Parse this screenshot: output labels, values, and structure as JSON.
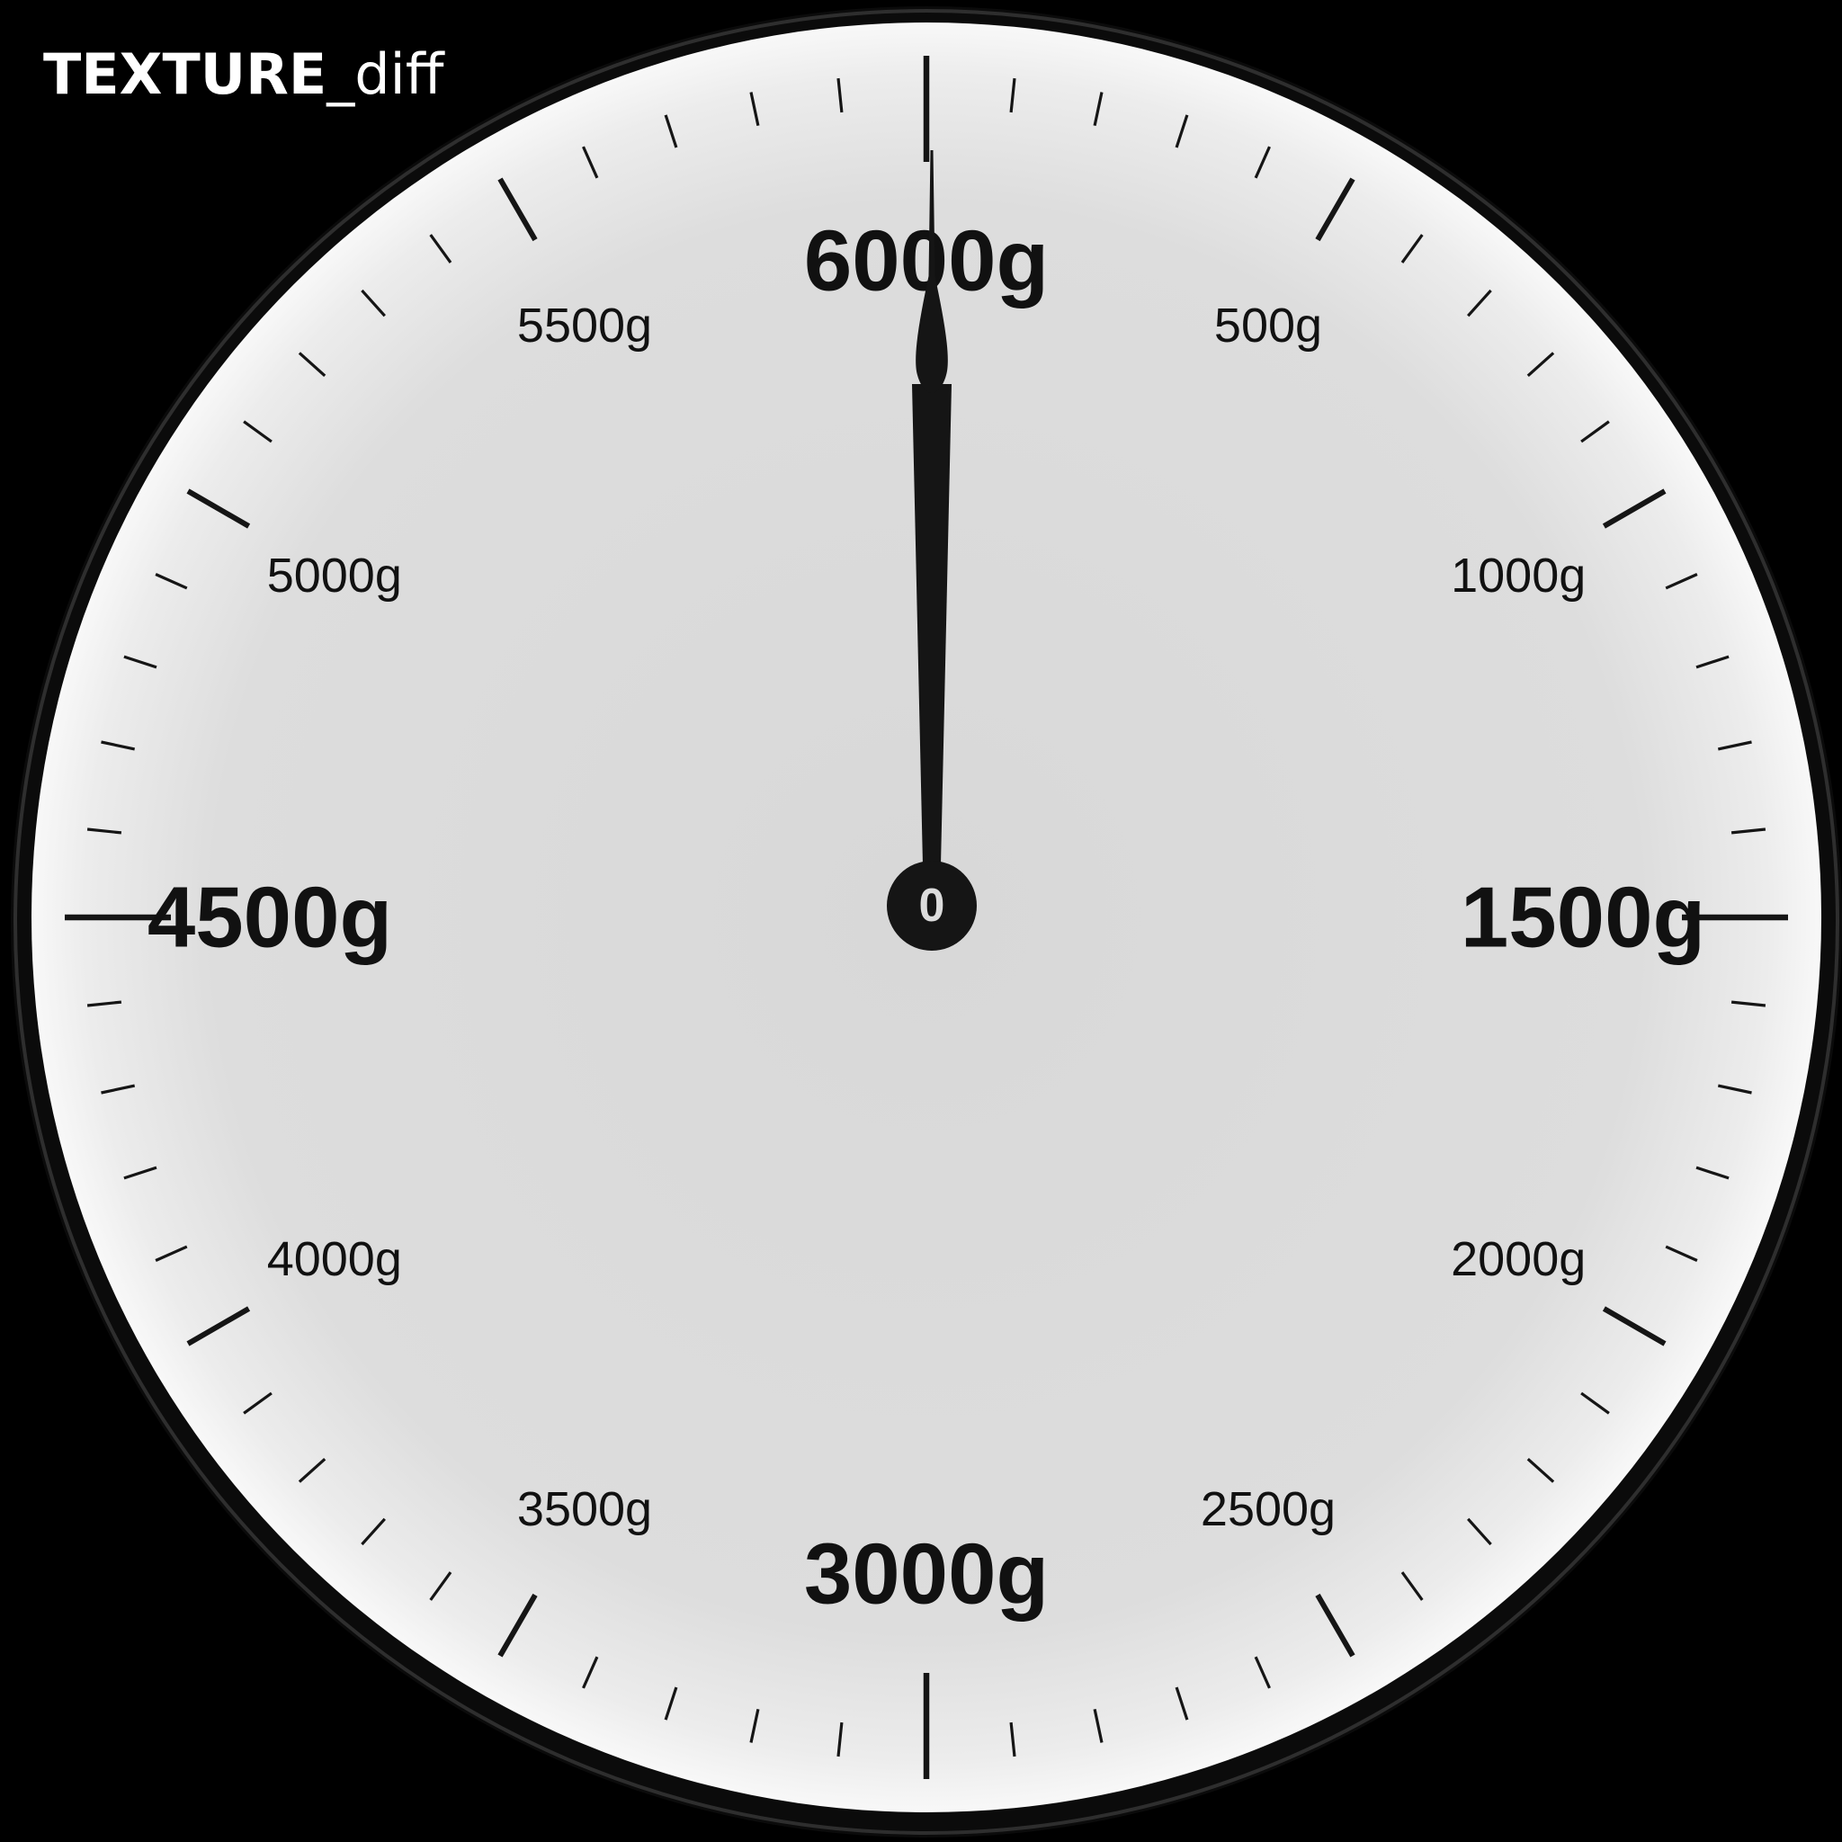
{
  "brand": {
    "bold": "TEXTURE",
    "light": "_diff"
  },
  "gauge": {
    "reading_g": 0,
    "max_g": 6000,
    "hub_label": "0",
    "labels": [
      {
        "text": "500g",
        "value": 500,
        "major": false
      },
      {
        "text": "1000g",
        "value": 1000,
        "major": false
      },
      {
        "text": "1500g",
        "value": 1500,
        "major": true
      },
      {
        "text": "2000g",
        "value": 2000,
        "major": false
      },
      {
        "text": "2500g",
        "value": 2500,
        "major": false
      },
      {
        "text": "3000g",
        "value": 3000,
        "major": true
      },
      {
        "text": "3500g",
        "value": 3500,
        "major": false
      },
      {
        "text": "4000g",
        "value": 4000,
        "major": false
      },
      {
        "text": "4500g",
        "value": 4500,
        "major": true
      },
      {
        "text": "5000g",
        "value": 5000,
        "major": false
      },
      {
        "text": "5500g",
        "value": 5500,
        "major": false
      },
      {
        "text": "6000g",
        "value": 6000,
        "major": true
      }
    ],
    "colors": {
      "face_center": "#dcdcdc",
      "face_edge": "#fafafa",
      "ink": "#151515",
      "bezel": "#0b0b0b"
    }
  }
}
